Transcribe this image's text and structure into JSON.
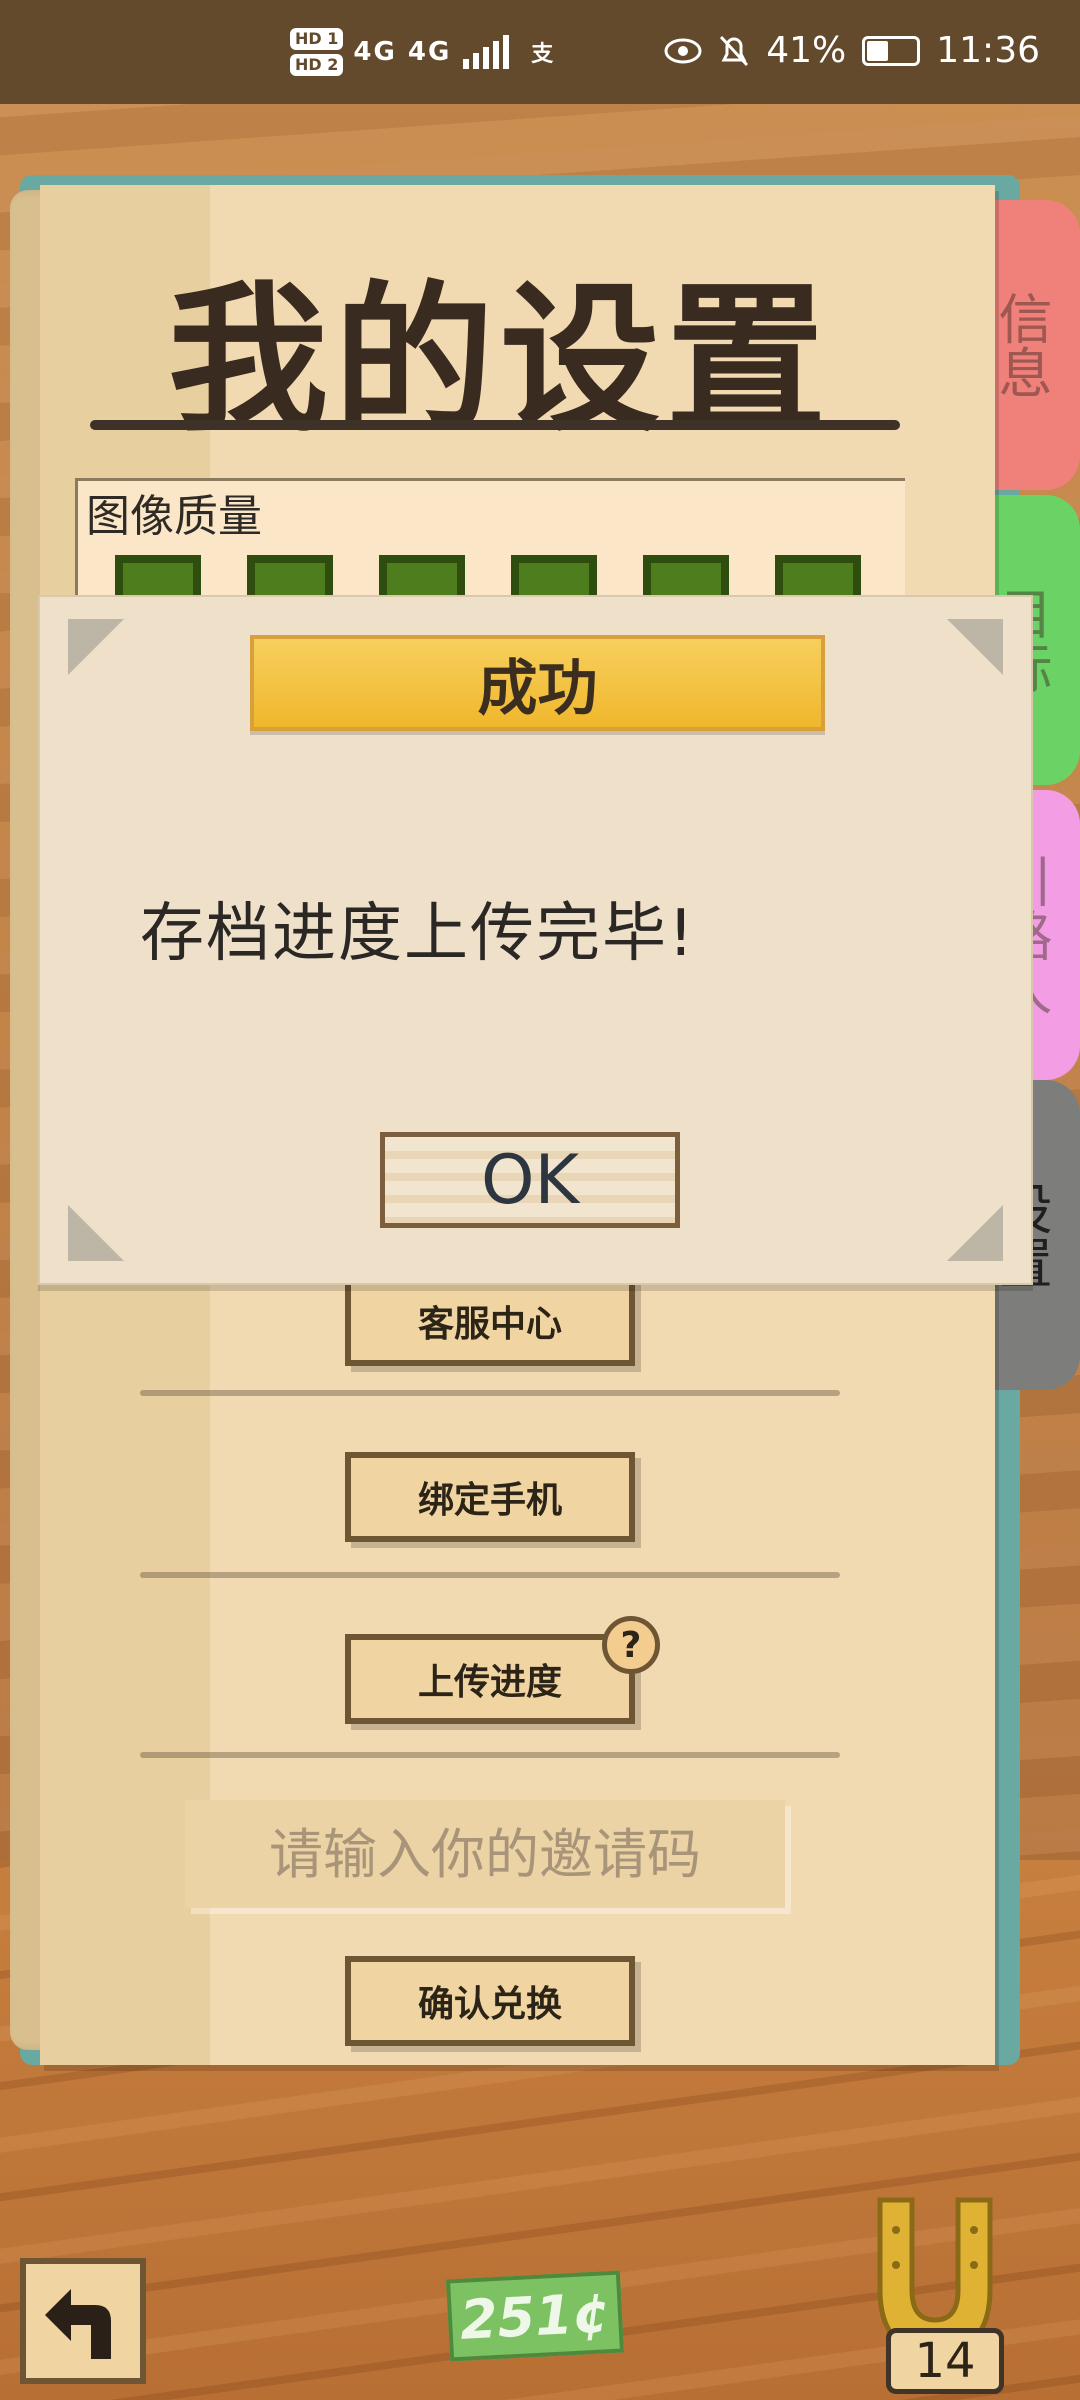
{
  "status_bar": {
    "hd1": "HD 1",
    "hd2": "HD 2",
    "signal": "4G 4G",
    "alipay": "支",
    "battery": "41%",
    "time": "11:36"
  },
  "tabs": {
    "info": "信息",
    "goal": "目标",
    "guide": "引路人",
    "settings": "设置"
  },
  "page": {
    "title": "我的设置",
    "image_quality_label": "图像质量"
  },
  "buttons": {
    "customer_service": "客服中心",
    "bind_phone": "绑定手机",
    "upload_progress": "上传进度",
    "help": "?",
    "confirm_redeem": "确认兑换"
  },
  "invite": {
    "placeholder": "请输入你的邀请码"
  },
  "modal": {
    "title": "成功",
    "message": "存档进度上传完毕!",
    "ok": "OK"
  },
  "bottom": {
    "money": "251¢",
    "horseshoe_count": "14"
  },
  "colors": {
    "tab_info": "#f0807a",
    "tab_goal": "#6bd266",
    "tab_guide": "#f39de4",
    "tab_settings": "#7d7d7b",
    "banner": "#f0b72c",
    "money_green": "#7cc262"
  }
}
